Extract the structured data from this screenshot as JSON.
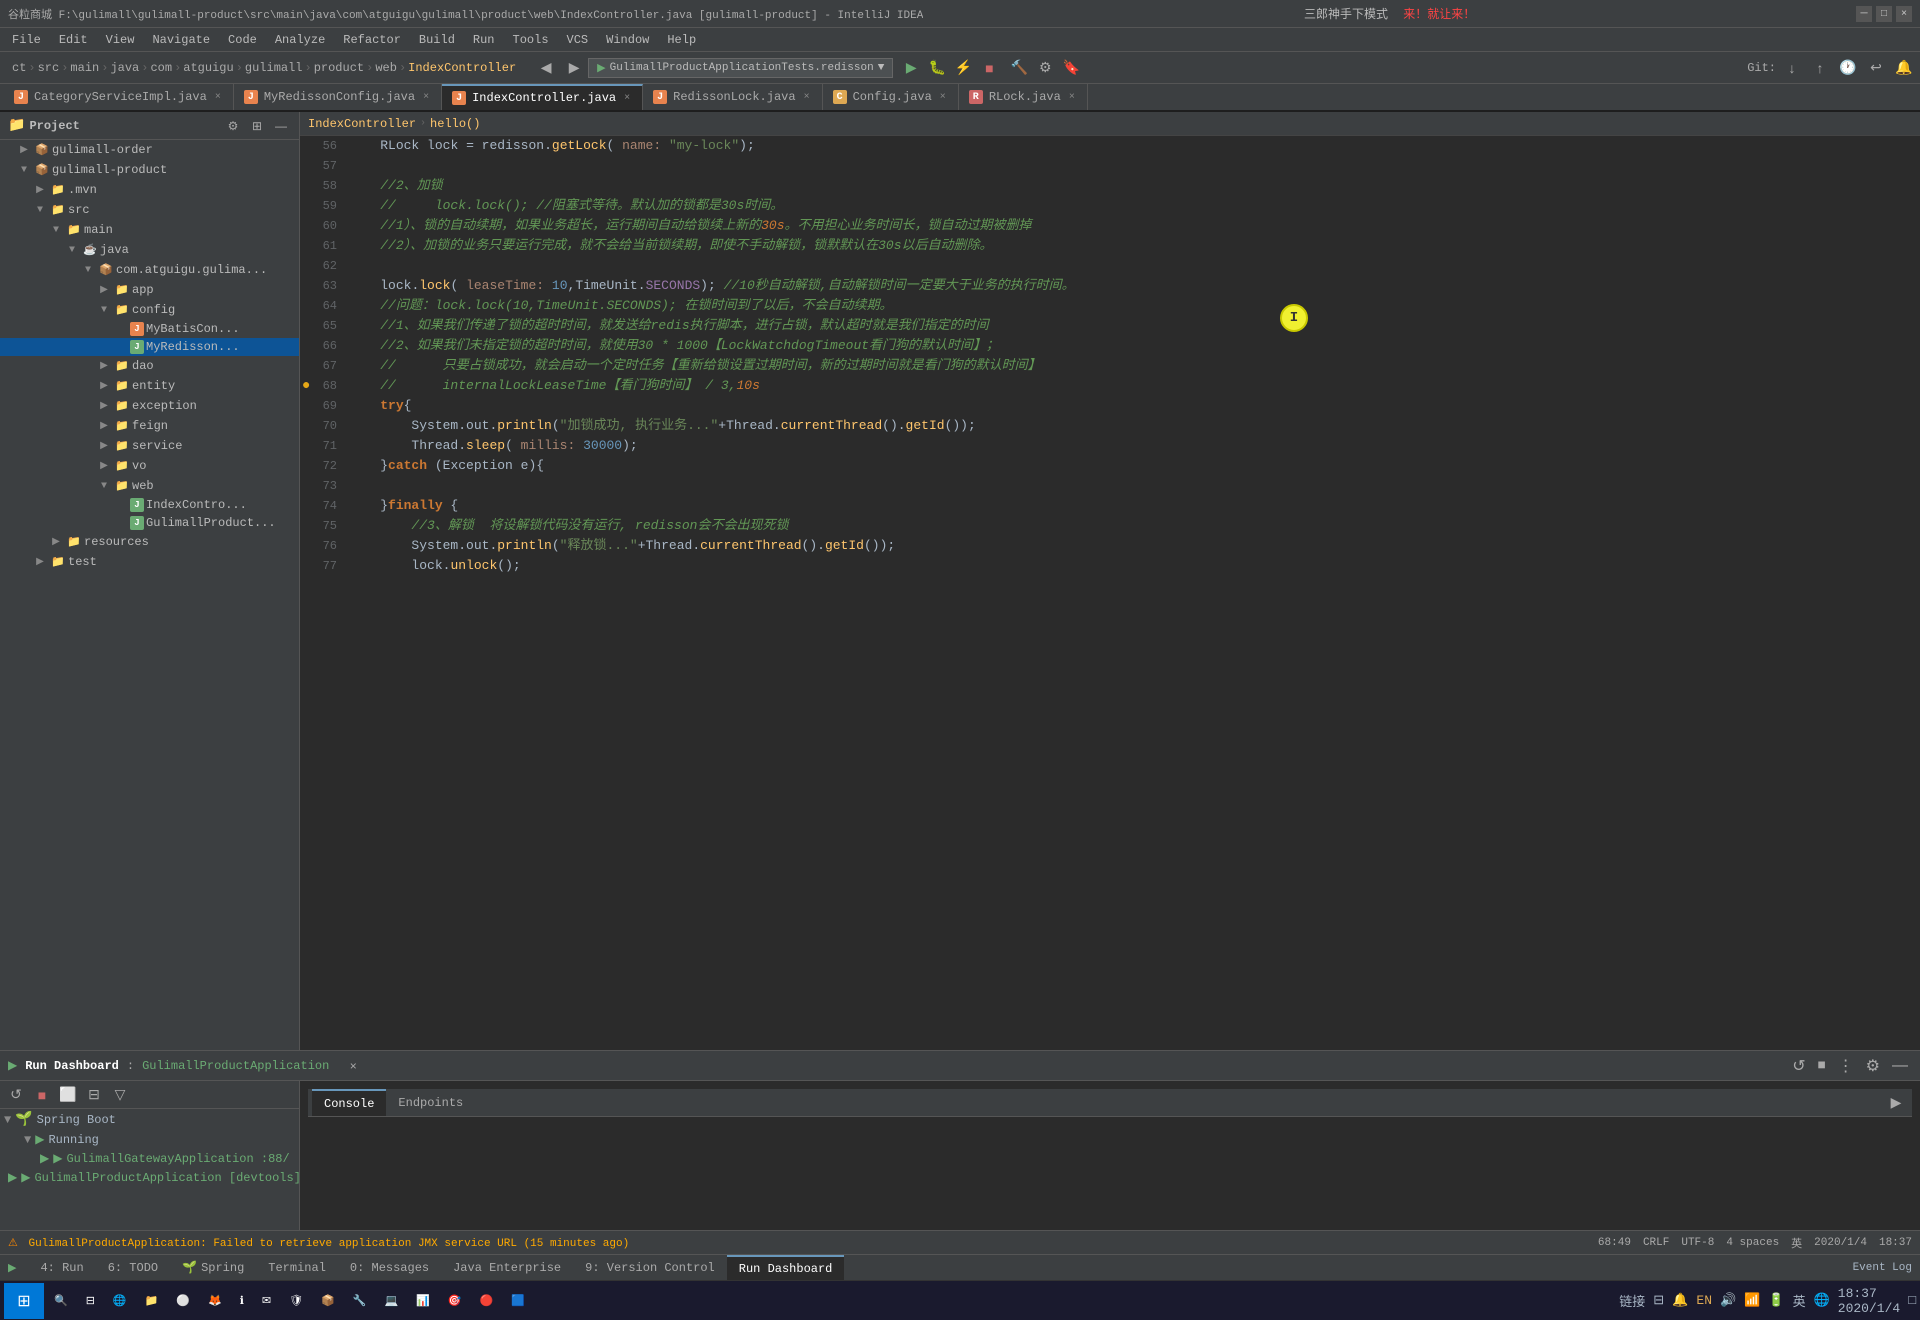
{
  "titlebar": {
    "path": "谷粒商城 F:\\gulimall\\gulimall-product\\src\\main\\java\\com\\atguigu\\gulimall\\product\\web\\IndexController.java [gulimall-product] - IntelliJ IDEA",
    "banner": "三郎神手下模式",
    "banner_red": "来！就让来！"
  },
  "menubar": {
    "items": [
      "File",
      "Edit",
      "View",
      "Navigate",
      "Code",
      "Analyze",
      "Refactor",
      "Build",
      "Run",
      "Tools",
      "VCS",
      "Window",
      "Help"
    ]
  },
  "breadcrumb": {
    "items": [
      "ct",
      "src",
      "main",
      "java",
      "com",
      "atguigu",
      "gulimall",
      "product",
      "web",
      "IndexController"
    ]
  },
  "run_config": "GulimallProductApplicationTests.redisson",
  "tabs": [
    {
      "label": "CategoryServiceImpl.java",
      "type": "java",
      "active": false
    },
    {
      "label": "MyRedissonConfig.java",
      "type": "java",
      "active": false
    },
    {
      "label": "IndexController.java",
      "type": "java",
      "active": true
    },
    {
      "label": "RedissonLock.java",
      "type": "java",
      "active": false
    },
    {
      "label": "Config.java",
      "type": "config",
      "active": false
    },
    {
      "label": "RLock.java",
      "type": "java",
      "active": false
    }
  ],
  "editor": {
    "lines": [
      {
        "num": 56,
        "content": "    RLock lock = redisson.getLock( name: \"my-lock\");"
      },
      {
        "num": 57,
        "content": ""
      },
      {
        "num": 58,
        "content": "    //2、加锁"
      },
      {
        "num": 59,
        "content": "    //     lock.lock(); //阻塞式等待。默认加的锁都是30s时间。"
      },
      {
        "num": 60,
        "content": "    //1）、锁的自动续期，如果业务超长，运行期间自动给锁续上新的30s。不用担心业务时间长，锁自动过期被删掉"
      },
      {
        "num": 61,
        "content": "    //2）、加锁的业务只要运行完成，就不会给当前锁续期，即使不手动解锁，锁默认认在30s以后自动删除。"
      },
      {
        "num": 62,
        "content": ""
      },
      {
        "num": 63,
        "content": "    lock.lock( leaseTime: 10,TimeUnit.SECONDS); //10秒自动解锁,自动解锁时间一定要大于业务的执行时间。"
      },
      {
        "num": 64,
        "content": "    //问题：lock.lock(10,TimeUnit.SECONDS); 在锁时间到了以后，不会自动续期。"
      },
      {
        "num": 65,
        "content": "    //1、如果我们传递了锁的超时时间，就发送给redis执行脚本，进行占锁，默认超时就是我们指定的时间"
      },
      {
        "num": 66,
        "content": "    //2、如果我们未指定锁的超时时间，就使用30 * 1000【LockWatchdogTimeout看门狗的默认时间】；"
      },
      {
        "num": 67,
        "content": "    //      只要占锁成功，就会启动一个定时任务【重新给锁设置过期时间，新的过期时间就是看门狗的默认时间】"
      },
      {
        "num": 68,
        "content": "    //      internalLockLeaseTime【看门狗时间】 / 3,10s",
        "has_gutter": true
      },
      {
        "num": 69,
        "content": "    try{"
      },
      {
        "num": 70,
        "content": "        System.out.println(\"加锁成功, 执行业务...\"+Thread.currentThread().getId());"
      },
      {
        "num": 71,
        "content": "        Thread.sleep( millis: 30000);"
      },
      {
        "num": 72,
        "content": "    }catch (Exception e){"
      },
      {
        "num": 73,
        "content": ""
      },
      {
        "num": 74,
        "content": "    }finally {"
      },
      {
        "num": 75,
        "content": "        //3、解锁  将设解锁代码没有运行, redisson会不会出现死锁"
      },
      {
        "num": 76,
        "content": "        System.out.println(\"释放锁...\"+Thread.currentThread().getId());"
      },
      {
        "num": 77,
        "content": "        lock.unlock();"
      }
    ]
  },
  "editor_breadcrumb": {
    "controller": "IndexController",
    "method": "hello()"
  },
  "run_dashboard": {
    "title": "Run Dashboard",
    "app": "GulimallProductApplication",
    "close": "×"
  },
  "bottom_tabs": [
    "Console",
    "Endpoints"
  ],
  "run_tree": {
    "spring_boot": "Spring Boot",
    "running": "Running",
    "gateway": "GulimallGatewayApplication :88/",
    "product": "GulimallProductApplication [devtools]"
  },
  "statusbar": {
    "message": "GulimallProductApplication: Failed to retrieve application JMX service URL (15 minutes ago)",
    "position": "68:49",
    "encoding": "CRLF",
    "charset": "UTF-8",
    "indent": "4 spaces",
    "lang": "英",
    "datetime": "2020/1/4",
    "time": "18:37"
  },
  "footer_tabs": [
    {
      "num": 4,
      "label": "Run"
    },
    {
      "num": 6,
      "label": "TODO"
    },
    {
      "label": "Spring"
    },
    {
      "label": "Terminal"
    },
    {
      "num": 0,
      "label": "Messages"
    },
    {
      "label": "Java Enterprise"
    },
    {
      "num": 9,
      "label": "Version Control"
    },
    {
      "label": "Run Dashboard"
    }
  ],
  "sidebar": {
    "project_label": "Project",
    "items": [
      {
        "label": "gulimall-order",
        "type": "module",
        "indent": 1,
        "collapsed": true
      },
      {
        "label": "gulimall-product",
        "type": "module",
        "indent": 1,
        "collapsed": false
      },
      {
        "label": ".mvn",
        "type": "folder",
        "indent": 2,
        "collapsed": true
      },
      {
        "label": "src",
        "type": "folder",
        "indent": 2,
        "collapsed": false
      },
      {
        "label": "main",
        "type": "folder",
        "indent": 3,
        "collapsed": false
      },
      {
        "label": "java",
        "type": "folder",
        "indent": 4,
        "collapsed": false
      },
      {
        "label": "com.atguigu.gulima...",
        "type": "package",
        "indent": 5,
        "collapsed": false
      },
      {
        "label": "app",
        "type": "folder",
        "indent": 6,
        "collapsed": true
      },
      {
        "label": "config",
        "type": "folder",
        "indent": 6,
        "collapsed": false
      },
      {
        "label": "MyBatisCon...",
        "type": "java",
        "indent": 7
      },
      {
        "label": "MyRedisson...",
        "type": "java-spring",
        "indent": 7
      },
      {
        "label": "dao",
        "type": "folder",
        "indent": 6,
        "collapsed": true
      },
      {
        "label": "entity",
        "type": "folder",
        "indent": 6,
        "collapsed": true
      },
      {
        "label": "exception",
        "type": "folder",
        "indent": 6,
        "collapsed": true
      },
      {
        "label": "feign",
        "type": "folder",
        "indent": 6,
        "collapsed": true
      },
      {
        "label": "service",
        "type": "folder",
        "indent": 6,
        "collapsed": true
      },
      {
        "label": "vo",
        "type": "folder",
        "indent": 6,
        "collapsed": true
      },
      {
        "label": "web",
        "type": "folder",
        "indent": 6,
        "collapsed": false
      },
      {
        "label": "IndexContro...",
        "type": "java-spring",
        "indent": 7
      },
      {
        "label": "GulimallProduct...",
        "type": "java-spring",
        "indent": 7
      },
      {
        "label": "resources",
        "type": "folder",
        "indent": 3,
        "collapsed": true
      },
      {
        "label": "test",
        "type": "folder",
        "indent": 2,
        "collapsed": true
      }
    ]
  }
}
